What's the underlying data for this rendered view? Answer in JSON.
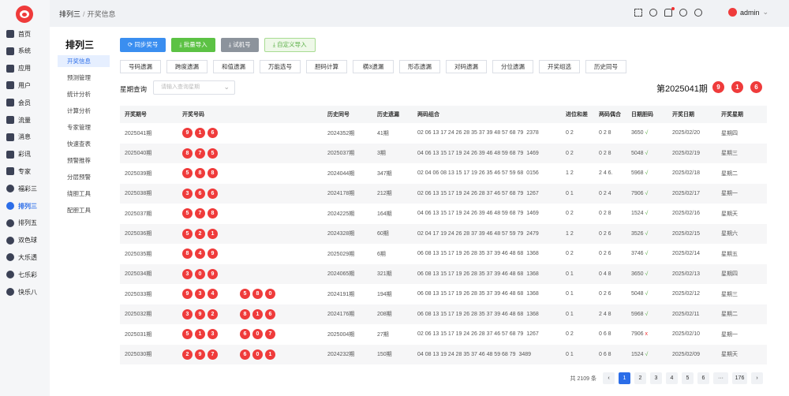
{
  "nav": [
    "首页",
    "系统",
    "应用",
    "用户",
    "会员",
    "流量",
    "消息",
    "彩讯",
    "专家",
    "福彩三",
    "排列三",
    "排列五",
    "双色球",
    "大乐透",
    "七乐彩",
    "快乐八"
  ],
  "breadcrumb": {
    "parent": "排列三",
    "current": "开奖信息"
  },
  "user": {
    "name": "admin"
  },
  "submenu": {
    "title": "排列三",
    "items": [
      "开奖信息",
      "预测管理",
      "统计分析",
      "计算分析",
      "专家管理",
      "快速查表",
      "预警推荐",
      "分层预警",
      "绕胆工具",
      "配胆工具"
    ]
  },
  "actions": {
    "sync": "同步奖号",
    "batch_import": "批量导入",
    "test": "试机号",
    "custom_import": "自定义导入"
  },
  "chips": [
    "号码遗漏",
    "跨度遗漏",
    "和值遗漏",
    "万能选号",
    "胆码计算",
    "横3遗漏",
    "形态遗漏",
    "对码遗漏",
    "分位遗漏",
    "开奖组选",
    "历史同号"
  ],
  "query": {
    "label": "星期查询",
    "placeholder": "请输入查询星期"
  },
  "latest": {
    "title": "第2025041期",
    "balls": [
      "9",
      "1",
      "6"
    ]
  },
  "table": {
    "headers": [
      "开奖期号",
      "开奖号码",
      "历史同号",
      "历史遗漏",
      "两码组合",
      "进位和差",
      "两码偶合",
      "日期胆码",
      "开奖日期",
      "开奖星期"
    ],
    "rows": [
      {
        "issue": "2025041期",
        "balls": [
          "9",
          "1",
          "6"
        ],
        "extra": [],
        "hist": "2024352期",
        "miss": "41期",
        "combo": "02 06 13 17 24 26 28 35 37 39 48 57 68 79",
        "n": "2378",
        "carry": "0 2",
        "even": "0 2 8",
        "dan": "3650",
        "mark": "√",
        "date": "2025/02/20",
        "week": "星期四"
      },
      {
        "issue": "2025040期",
        "balls": [
          "8",
          "7",
          "5"
        ],
        "extra": [],
        "hist": "2025037期",
        "miss": "3期",
        "combo": "04 06 13 15 17 19 24 26 39 46 48 59 68 79",
        "n": "1469",
        "carry": "0 2",
        "even": "0 2 8",
        "dan": "5048",
        "mark": "√",
        "date": "2025/02/19",
        "week": "星期三"
      },
      {
        "issue": "2025039期",
        "balls": [
          "5",
          "8",
          "8"
        ],
        "extra": [],
        "hist": "2024044期",
        "miss": "347期",
        "combo": "02 04 06 08 13 15 17 19 26 35 46 57 59 68",
        "n": "0156",
        "carry": "1 2",
        "even": "2 4 6.",
        "dan": "5968",
        "mark": "√",
        "date": "2025/02/18",
        "week": "星期二"
      },
      {
        "issue": "2025038期",
        "balls": [
          "3",
          "6",
          "6"
        ],
        "extra": [],
        "hist": "2024178期",
        "miss": "212期",
        "combo": "02 06 13 15 17 19 24 26 28 37 46 57 68 79",
        "n": "1267",
        "carry": "0 1",
        "even": "0 2 4",
        "dan": "7906",
        "mark": "√",
        "date": "2025/02/17",
        "week": "星期一"
      },
      {
        "issue": "2025037期",
        "balls": [
          "5",
          "7",
          "8"
        ],
        "extra": [],
        "hist": "2024225期",
        "miss": "164期",
        "combo": "04 06 13 15 17 19 24 26 39 46 48 59 68 79",
        "n": "1469",
        "carry": "0 2",
        "even": "0 2 8",
        "dan": "1524",
        "mark": "√",
        "date": "2025/02/16",
        "week": "星期天"
      },
      {
        "issue": "2025036期",
        "balls": [
          "5",
          "2",
          "1"
        ],
        "extra": [],
        "hist": "2024328期",
        "miss": "60期",
        "combo": "02 04 17 19 24 26 28 37 39 46 48 57 59 79",
        "n": "2479",
        "carry": "1 2",
        "even": "0 2 6",
        "dan": "3526",
        "mark": "√",
        "date": "2025/02/15",
        "week": "星期六"
      },
      {
        "issue": "2025035期",
        "balls": [
          "8",
          "4",
          "9"
        ],
        "extra": [],
        "hist": "2025029期",
        "miss": "6期",
        "combo": "06 08 13 15 17 19 26 28 35 37 39 46 48 68",
        "n": "1368",
        "carry": "0 2",
        "even": "0 2 6",
        "dan": "3746",
        "mark": "√",
        "date": "2025/02/14",
        "week": "星期五"
      },
      {
        "issue": "2025034期",
        "balls": [
          "3",
          "0",
          "9"
        ],
        "extra": [],
        "hist": "2024065期",
        "miss": "321期",
        "combo": "06 08 13 15 17 19 26 28 35 37 39 46 48 68",
        "n": "1368",
        "carry": "0 1",
        "even": "0 4 8",
        "dan": "3650",
        "mark": "√",
        "date": "2025/02/13",
        "week": "星期四"
      },
      {
        "issue": "2025033期",
        "balls": [
          "9",
          "3",
          "4"
        ],
        "extra": [
          "5",
          "8",
          "0"
        ],
        "hist": "2024191期",
        "miss": "194期",
        "combo": "06 08 13 15 17 19 26 28 35 37 39 46 48 68",
        "n": "1368",
        "carry": "0 1",
        "even": "0 2 6",
        "dan": "5048",
        "mark": "√",
        "date": "2025/02/12",
        "week": "星期三"
      },
      {
        "issue": "2025032期",
        "balls": [
          "3",
          "9",
          "2"
        ],
        "extra": [
          "8",
          "1",
          "6"
        ],
        "hist": "2024176期",
        "miss": "208期",
        "combo": "06 08 13 15 17 19 26 28 35 37 39 46 48 68",
        "n": "1368",
        "carry": "0 1",
        "even": "2 4 8",
        "dan": "5968",
        "mark": "√",
        "date": "2025/02/11",
        "week": "星期二"
      },
      {
        "issue": "2025031期",
        "balls": [
          "5",
          "1",
          "3"
        ],
        "extra": [
          "6",
          "0",
          "7"
        ],
        "hist": "2025004期",
        "miss": "27期",
        "combo": "02 06 13 15 17 19 24 26 28 37 46 57 68 79",
        "n": "1267",
        "carry": "0 2",
        "even": "0 6 8",
        "dan": "7906",
        "mark": "x",
        "date": "2025/02/10",
        "week": "星期一"
      },
      {
        "issue": "2025030期",
        "balls": [
          "2",
          "9",
          "7"
        ],
        "extra": [
          "6",
          "0",
          "1"
        ],
        "hist": "2024232期",
        "miss": "150期",
        "combo": "04 08 13 19 24 28 35 37 46 48 59 68 79",
        "n": "3489",
        "carry": "0 1",
        "even": "0 6 8",
        "dan": "1524",
        "mark": "√",
        "date": "2025/02/09",
        "week": "星期天"
      }
    ]
  },
  "pagination": {
    "total": "共 2109 条",
    "prev": "‹",
    "next": "›",
    "pages": [
      "1",
      "2",
      "3",
      "4",
      "5",
      "6",
      "···",
      "176"
    ]
  },
  "colors": {
    "primary": "#2b6de8",
    "ball": "#ef3b3b",
    "success": "#5cb048",
    "danger": "#f03030"
  }
}
